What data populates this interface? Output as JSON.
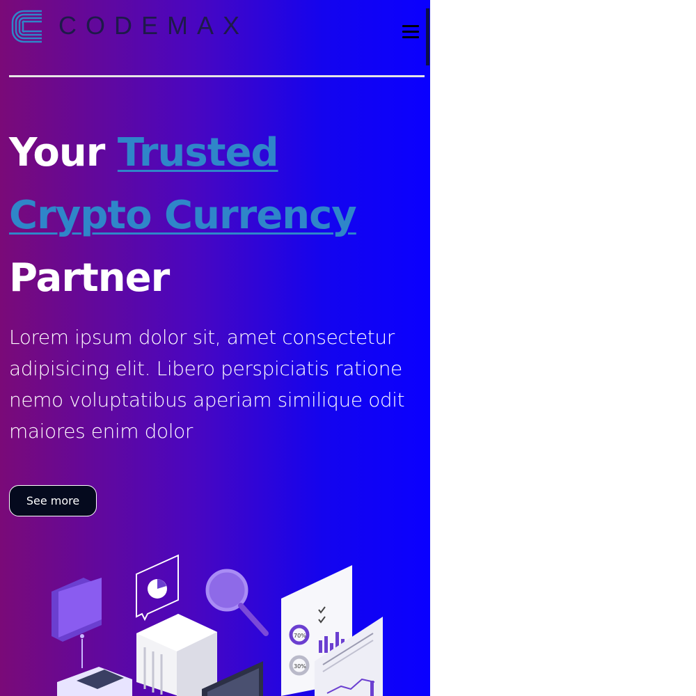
{
  "header": {
    "brand": "CODEMAX",
    "logo_icon": "logo-c-icon",
    "menu_icon": "hamburger-icon"
  },
  "hero": {
    "title_part1": "Your ",
    "title_link1": "Trusted",
    "title_link2": "Crypto Currency",
    "title_part2": "Partner",
    "description": "Lorem ipsum dolor sit, amet consectetur adipisicing elit. Libero perspiciatis ratione nemo voluptatibus aperiam similique odit maiores enim dolor",
    "cta_label": "See more"
  },
  "illustration": {
    "label_70": "70%",
    "label_30": "30%"
  },
  "colors": {
    "gradient_start": "#7a0a78",
    "gradient_end": "#0a00ff",
    "link": "#2f86c9",
    "button_bg": "#050a1e"
  }
}
